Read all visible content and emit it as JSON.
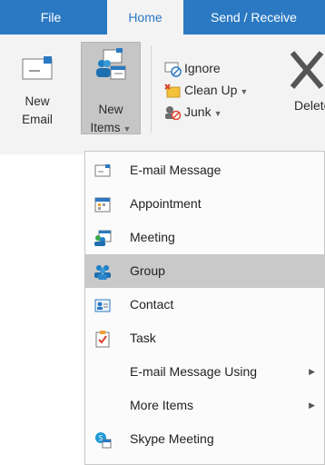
{
  "tabs": {
    "file": "File",
    "home": "Home",
    "send_receive": "Send / Receive"
  },
  "ribbon": {
    "new_email": {
      "line1": "New",
      "line2": "Email"
    },
    "new_items": {
      "line1": "New",
      "line2": "Items"
    },
    "ignore": "Ignore",
    "clean_up": "Clean Up",
    "junk": "Junk",
    "delete": "Delete"
  },
  "menu": {
    "items": [
      {
        "label": "E-mail Message",
        "icon": "email-message-icon"
      },
      {
        "label": "Appointment",
        "icon": "appointment-icon"
      },
      {
        "label": "Meeting",
        "icon": "meeting-icon"
      },
      {
        "label": "Group",
        "icon": "group-icon",
        "highlighted": true
      },
      {
        "label": "Contact",
        "icon": "contact-icon"
      },
      {
        "label": "Task",
        "icon": "task-icon"
      },
      {
        "label": "E-mail Message Using",
        "submenu": true
      },
      {
        "label": "More Items",
        "submenu": true
      },
      {
        "label": "Skype Meeting",
        "icon": "skype-meeting-icon"
      }
    ]
  },
  "colors": {
    "accent": "#2b79c2",
    "ribbon_bg": "#f3f3f3",
    "highlight": "#c9c9c9"
  }
}
